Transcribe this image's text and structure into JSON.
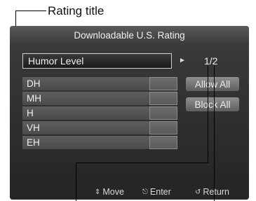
{
  "callout": {
    "label": "Rating title"
  },
  "window": {
    "title": "Downloadable U.S. Rating",
    "rating_title": "Humor Level",
    "page_indicator": "1/2",
    "ratings": [
      {
        "label": "DH"
      },
      {
        "label": "MH"
      },
      {
        "label": "H"
      },
      {
        "label": "VH"
      },
      {
        "label": "EH"
      }
    ],
    "buttons": {
      "allow_all": "Allow All",
      "block_all": "Block All"
    }
  },
  "footer": {
    "move": "Move",
    "enter": "Enter",
    "return": "Return",
    "icons": [
      "updown-icon",
      "enter-icon",
      "return-icon"
    ]
  },
  "colors": {
    "panel": "#2b2b2b",
    "row": "#555555",
    "button": "#7a7a7a",
    "text": "#f0f0f0"
  }
}
